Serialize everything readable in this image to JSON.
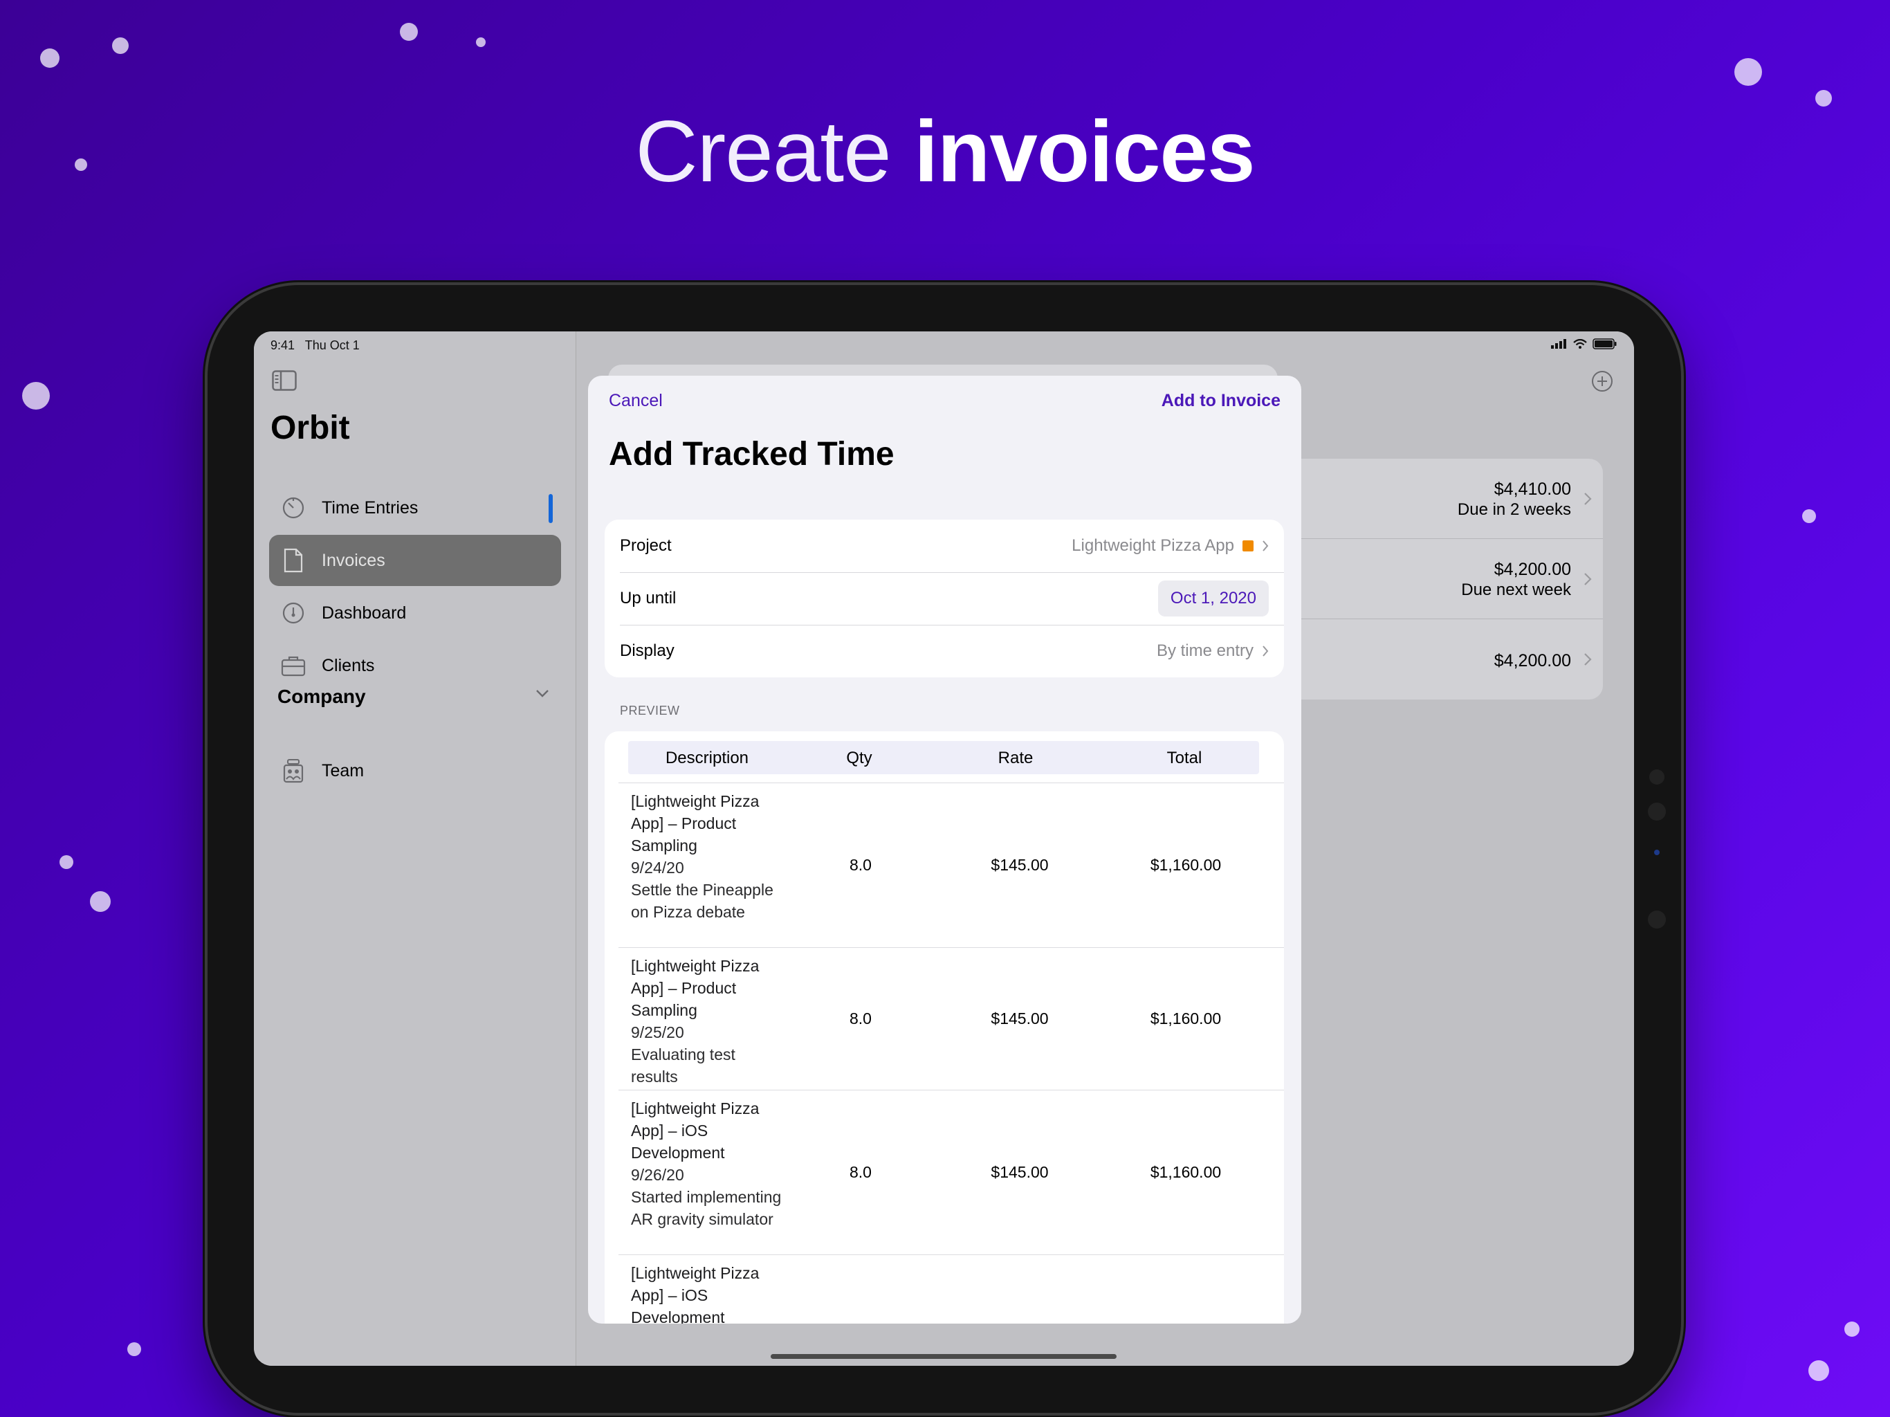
{
  "headline": {
    "light": "Create",
    "bold": "invoices"
  },
  "status_bar": {
    "time": "9:41",
    "date": "Thu Oct 1"
  },
  "sidebar": {
    "app_title": "Orbit",
    "items": [
      {
        "label": "Time Entries",
        "icon": "timer-icon"
      },
      {
        "label": "Invoices",
        "icon": "document-icon"
      },
      {
        "label": "Dashboard",
        "icon": "gauge-icon"
      },
      {
        "label": "Clients",
        "icon": "briefcase-icon"
      }
    ],
    "section": {
      "label": "Company"
    },
    "section_items": [
      {
        "label": "Team",
        "icon": "team-icon"
      }
    ]
  },
  "invoices": [
    {
      "amount": "$4,410.00",
      "due": "Due in 2 weeks"
    },
    {
      "amount": "$4,200.00",
      "due": "Due next week"
    },
    {
      "amount": "$4,200.00",
      "due": ""
    }
  ],
  "sheet": {
    "cancel": "Cancel",
    "add": "Add to Invoice",
    "title": "Add Tracked Time",
    "form": {
      "project_label": "Project",
      "project_value": "Lightweight Pizza App",
      "project_color": "#f08a00",
      "upuntil_label": "Up until",
      "upuntil_value": "Oct 1, 2020",
      "display_label": "Display",
      "display_value": "By time entry"
    },
    "preview_label": "PREVIEW",
    "table": {
      "headers": [
        "Description",
        "Qty",
        "Rate",
        "Total"
      ],
      "rows": [
        {
          "title": "[Lightweight Pizza App] – Product Sampling",
          "date": "9/24/20",
          "note": "Settle the Pineapple on Pizza debate",
          "qty": "8.0",
          "rate": "$145.00",
          "total": "$1,160.00"
        },
        {
          "title": "[Lightweight Pizza App] – Product Sampling",
          "date": "9/25/20",
          "note": "Evaluating test results",
          "qty": "8.0",
          "rate": "$145.00",
          "total": "$1,160.00"
        },
        {
          "title": "[Lightweight Pizza App] – iOS Development",
          "date": "9/26/20",
          "note": "Started implementing AR gravity simulator",
          "qty": "8.0",
          "rate": "$145.00",
          "total": "$1,160.00"
        },
        {
          "title": "[Lightweight Pizza App] – iOS Development",
          "date": "",
          "note": "",
          "qty": "",
          "rate": "",
          "total": ""
        }
      ]
    }
  },
  "colors": {
    "accent": "#4b18b8",
    "selection": "#6f6f6f",
    "focus": "#1466d8"
  }
}
